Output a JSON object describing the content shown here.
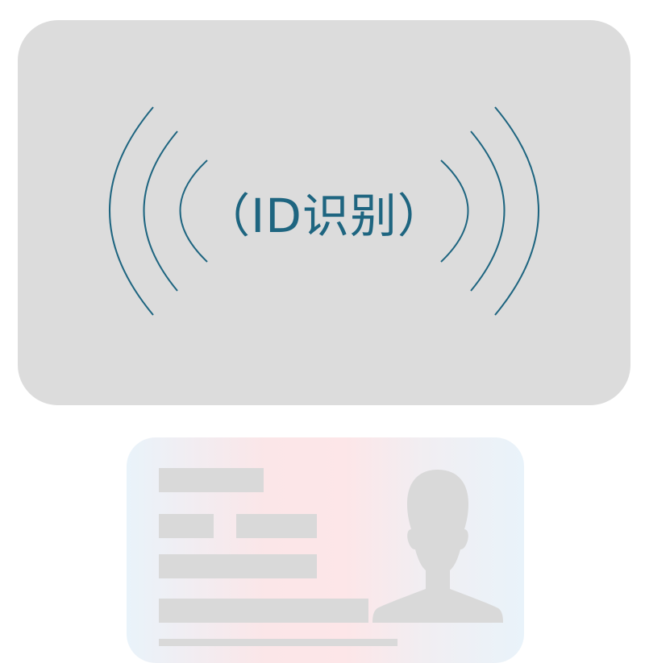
{
  "reader": {
    "label": "（ID识别）",
    "accent_color": "#1e6580",
    "background_color": "#dcdcdc",
    "icon": "nfc-signal-waves-icon"
  },
  "id_card": {
    "icon": "person-silhouette-icon",
    "placeholder_color": "#d9d9d9"
  }
}
